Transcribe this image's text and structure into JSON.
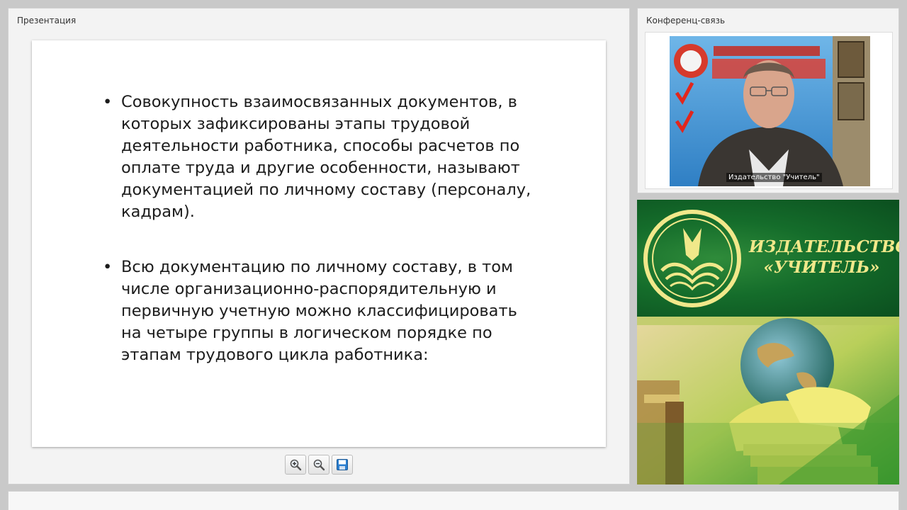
{
  "presentation": {
    "title": "Презентация",
    "slide": {
      "bullets": [
        "Совокупность взаимосвязанных документов, в которых зафиксированы этапы трудовой деятельности работника, способы расчетов по оплате труда и другие особенности, называют документацией по личному составу (персоналу, кадрам).",
        "Всю документацию по личному составу, в том числе организационно-распорядительную и первичную учетную можно классифицировать на четыре группы в логическом порядке по этапам трудового цикла работника:"
      ],
      "bullet_symbol": "•"
    },
    "toolbar": {
      "zoom_in_icon": "zoom-in-icon",
      "zoom_out_icon": "zoom-out-icon",
      "save_icon": "floppy-save-icon"
    }
  },
  "conference": {
    "title": "Конференц-связь",
    "video_caption": "Издательство \"Учитель\""
  },
  "banner": {
    "line1": "ИЗДАТЕЛЬСТВО",
    "line2": "«УЧИТЕЛЬ»"
  },
  "colors": {
    "banner_green": "#156d2b",
    "banner_text": "#f1e88a",
    "accent_blue": "#2b7fd0"
  }
}
